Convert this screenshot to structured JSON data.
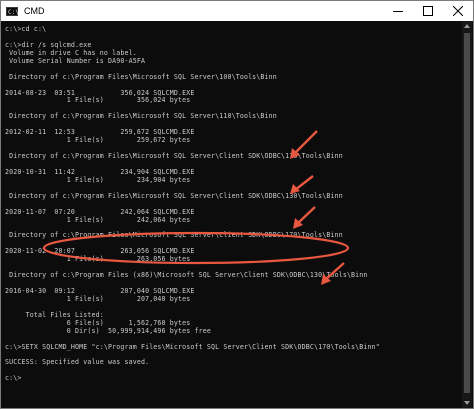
{
  "window": {
    "title": "CMD",
    "icon_label": "C:\\"
  },
  "console": {
    "lines": [
      "c:\\>cd c:\\",
      "",
      "c:\\>dir /s sqlcmd.exe",
      " Volume in drive C has no label.",
      " Volume Serial Number is DA90-A5FA",
      "",
      " Directory of c:\\Program Files\\Microsoft SQL Server\\100\\Tools\\Binn",
      "",
      "2014-08-23  03:51           356,024 SQLCMD.EXE",
      "               1 File(s)        356,024 bytes",
      "",
      " Directory of c:\\Program Files\\Microsoft SQL Server\\110\\Tools\\Binn",
      "",
      "2012-02-11  12:53           259,672 SQLCMD.EXE",
      "               1 File(s)        259,672 bytes",
      "",
      " Directory of c:\\Program Files\\Microsoft SQL Server\\Client SDK\\ODBC\\110\\Tools\\Binn",
      "",
      "2020-10-31  11:42           234,904 SQLCMD.EXE",
      "               1 File(s)        234,904 bytes",
      "",
      " Directory of c:\\Program Files\\Microsoft SQL Server\\Client SDK\\ODBC\\130\\Tools\\Binn",
      "",
      "2020-11-07  07:20           242,064 SQLCMD.EXE",
      "               1 File(s)        242,064 bytes",
      "",
      " Directory of c:\\Program Files\\Microsoft SQL Server\\Client SDK\\ODBC\\170\\Tools\\Binn",
      "",
      "2020-11-02  20:07           263,056 SQLCMD.EXE",
      "               1 File(s)        263,056 bytes",
      "",
      " Directory of c:\\Program Files (x86)\\Microsoft SQL Server\\Client SDK\\ODBC\\130\\Tools\\Binn",
      "",
      "2016-04-30  09:12           207,040 SQLCMD.EXE",
      "               1 File(s)        207,040 bytes",
      "",
      "     Total Files Listed:",
      "               6 File(s)      1,562,760 bytes",
      "               0 Dir(s)  50,999,914,496 bytes free",
      "",
      "c:\\>SETX SQLCMD_HOME \"c:\\Program Files\\Microsoft SQL Server\\Client SDK\\ODBC\\170\\Tools\\Binn\"",
      "",
      "SUCCESS: Specified value was saved.",
      "",
      "c:\\>"
    ]
  },
  "annotations": {
    "color": "#e8573f"
  }
}
